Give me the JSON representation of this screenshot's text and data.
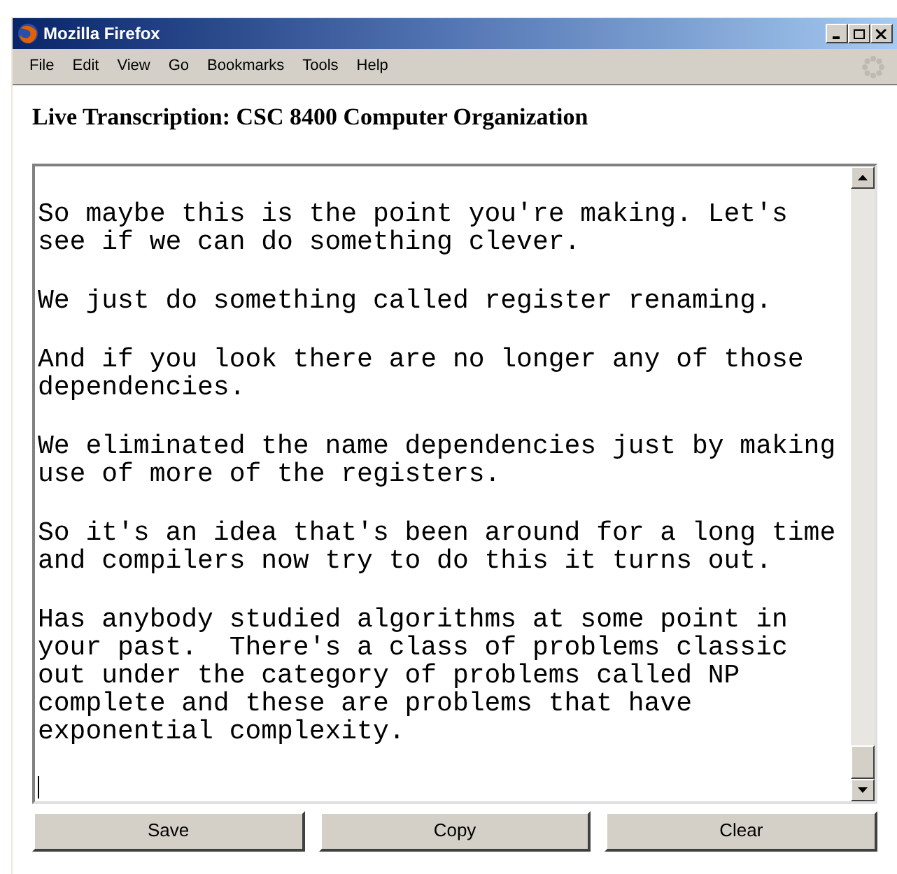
{
  "window": {
    "title": "Mozilla Firefox"
  },
  "menu": [
    "File",
    "Edit",
    "View",
    "Go",
    "Bookmarks",
    "Tools",
    "Help"
  ],
  "heading": "Live Transcription: CSC 8400 Computer Organization",
  "transcript": [
    {
      "lines": [
        "So maybe this is the point you're making. Let's",
        "see if we can do something clever."
      ]
    },
    {
      "lines": [
        "We just do something called register renaming."
      ]
    },
    {
      "lines": [
        "And if you look there are no longer any of those",
        "dependencies."
      ]
    },
    {
      "lines": [
        "We eliminated the name dependencies just by making",
        "use of more of the registers."
      ]
    },
    {
      "lines": [
        "So it's an idea that's been around for a long time",
        "and compilers now try to do this it turns out."
      ]
    },
    {
      "lines": [
        "Has anybody studied algorithms at some point in",
        "your past.  There's a class of problems classic",
        "out under the category of problems called NP",
        "complete and these are problems that have",
        "exponential complexity."
      ]
    }
  ],
  "buttons": [
    "Save",
    "Copy",
    "Clear"
  ]
}
